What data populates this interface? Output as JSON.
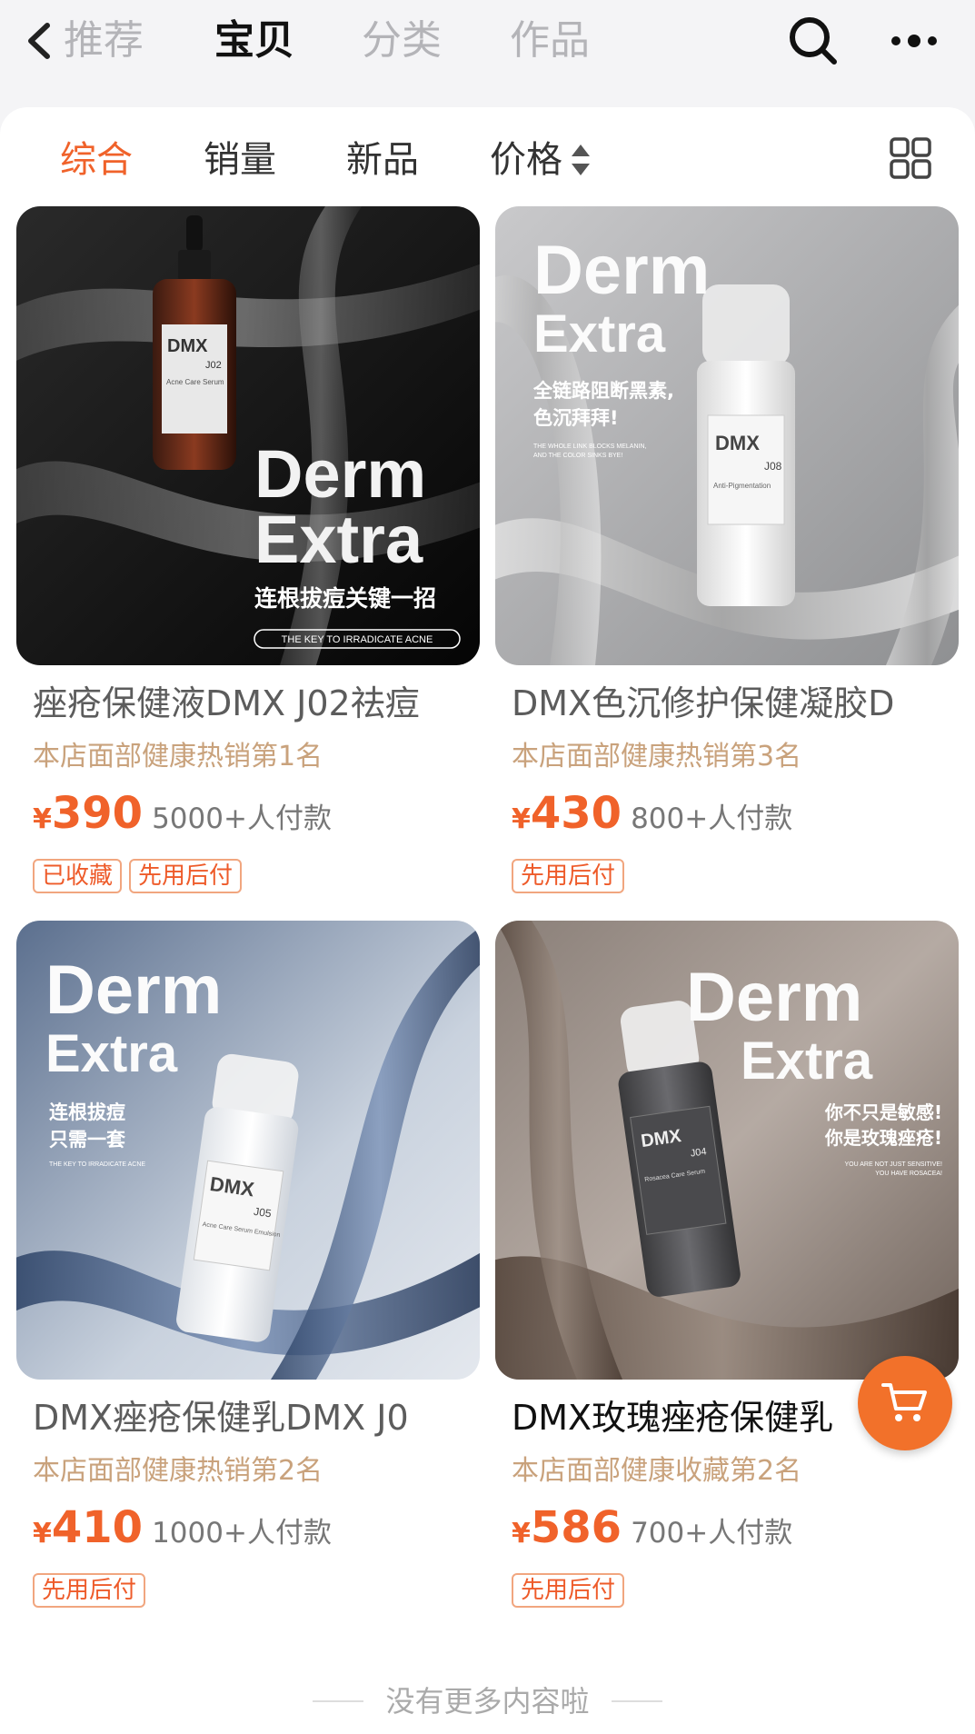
{
  "nav": {
    "tabs": [
      "推荐",
      "宝贝",
      "分类",
      "作品"
    ],
    "active_tab": "宝贝",
    "icons": [
      "back-icon",
      "search-icon",
      "more-icon"
    ]
  },
  "sort_bar": {
    "items": [
      "综合",
      "销量",
      "新品",
      "价格"
    ],
    "active": "综合",
    "icons": [
      "sort-arrows-icon",
      "grid-view-icon"
    ]
  },
  "colors": {
    "accent": "#f0622a",
    "rank_text": "#c9a27c",
    "badge_border": "#f1a67f"
  },
  "products": [
    {
      "title": "痤疮保健液DMX J02祛痘",
      "rank": "本店面部健康热销第1名",
      "currency": "¥",
      "price": "390",
      "sales": "5000+人付款",
      "badges": [
        "已收藏",
        "先用后付"
      ],
      "image": {
        "brand_line1": "Derm",
        "brand_line2": "Extra",
        "label_brand": "DMX",
        "label_code": "J02",
        "label_sub": "Acne Care Serum",
        "slogan": "连根拔痘关键一招",
        "tagline": "THE KEY TO IRRADICATE ACNE"
      }
    },
    {
      "title": "DMX色沉修护保健凝胶D",
      "rank": "本店面部健康热销第3名",
      "currency": "¥",
      "price": "430",
      "sales": "800+人付款",
      "badges": [
        "先用后付"
      ],
      "image": {
        "brand_line1": "Derm",
        "brand_line2": "Extra",
        "label_brand": "DMX",
        "label_code": "J08",
        "label_sub": "Anti-Pigmentation",
        "slogan_line1": "全链路阻断黑素,",
        "slogan_line2": "色沉拜拜!",
        "tagline_line1": "THE WHOLE LINK BLOCKS MELANIN,",
        "tagline_line2": "AND THE COLOR SINKS BYE!"
      }
    },
    {
      "title": "DMX痤疮保健乳DMX J0",
      "rank": "本店面部健康热销第2名",
      "currency": "¥",
      "price": "410",
      "sales": "1000+人付款",
      "badges": [
        "先用后付"
      ],
      "image": {
        "brand_line1": "Derm",
        "brand_line2": "Extra",
        "label_brand": "DMX",
        "label_code": "J05",
        "label_sub": "Acne Care Serum Emulsion",
        "slogan_line1": "连根拔痘",
        "slogan_line2": "只需一套",
        "tagline": "THE KEY TO IRRADICATE ACNE"
      }
    },
    {
      "title": "DMX玫瑰痤疮保健乳",
      "rank": "本店面部健康收藏第2名",
      "currency": "¥",
      "price": "586",
      "sales": "700+人付款",
      "badges": [
        "先用后付"
      ],
      "image": {
        "brand_line1": "Derm",
        "brand_line2": "Extra",
        "label_brand": "DMX",
        "label_code": "J04",
        "label_sub": "Rosacea Care Serum",
        "slogan_line1": "你不只是敏感!",
        "slogan_line2": "你是玫瑰痤疮!",
        "tagline_line1": "YOU ARE NOT JUST SENSITIVE!",
        "tagline_line2": "YOU HAVE ROSACEA!"
      }
    }
  ],
  "cart_fab_icon": "shopping-cart-icon",
  "footer": {
    "text": "没有更多内容啦"
  }
}
